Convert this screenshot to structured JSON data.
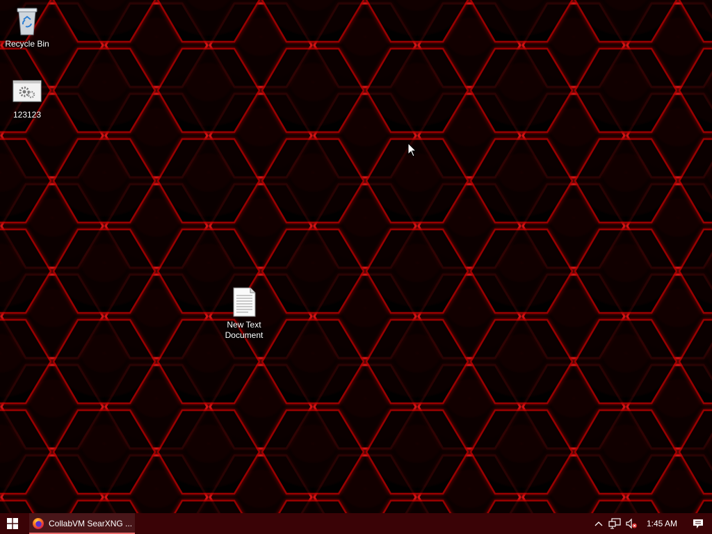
{
  "desktop": {
    "icons": [
      {
        "label": "Recycle Bin",
        "icon": "recycle-bin-icon"
      },
      {
        "label": "123123",
        "icon": "settings-shortcut-icon"
      },
      {
        "label": "New Text Document",
        "icon": "text-document-icon"
      }
    ],
    "wallpaper": {
      "base": "#050000",
      "glow": "#ff1a1a"
    }
  },
  "taskbar": {
    "background": "#3a0306",
    "start_icon": "windows-logo-icon",
    "windows": [
      {
        "title": "CollabVM SearXNG ...",
        "icon": "firefox-icon",
        "active_underline": "#e86a6a"
      }
    ],
    "tray": {
      "chevron_icon": "chevron-up-icon",
      "network_icon": "network-icon",
      "volume_icon": "volume-muted-icon",
      "clock": "1:45 AM",
      "notifications_icon": "action-center-icon"
    }
  }
}
